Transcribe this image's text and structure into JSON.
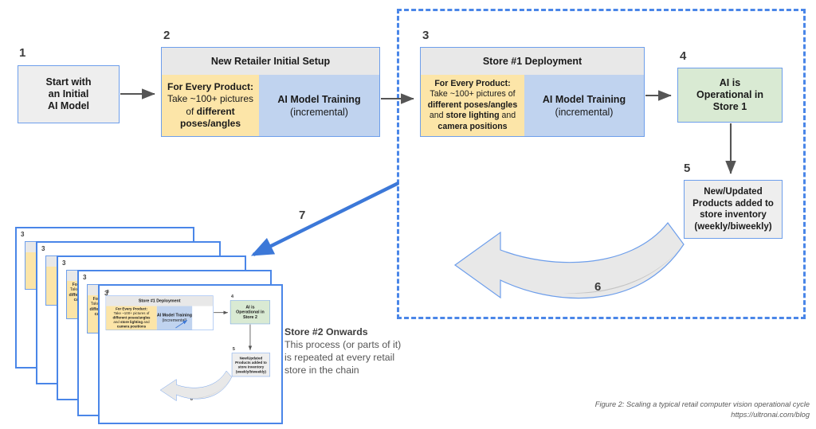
{
  "figure": {
    "caption": "Figure 2: Scaling a typical retail computer vision operational cycle",
    "source_url": "https://ultronai.com/blog"
  },
  "numbers": {
    "n1": "1",
    "n2": "2",
    "n3": "3",
    "n4": "4",
    "n5": "5",
    "n6": "6",
    "n7": "7"
  },
  "nodes": {
    "box1": {
      "number": "1",
      "line1": "Start with",
      "line2": "an Initial",
      "line3": "AI Model"
    },
    "box2": {
      "number": "2",
      "header": "New Retailer Initial Setup",
      "yellow": {
        "title": "For Every Product:",
        "l1": "Take ~100+ pictures",
        "l2_plain": "of ",
        "l2_bold": "different",
        "l3_bold": "poses/angles"
      },
      "blue": {
        "title": "AI Model Training",
        "subtitle": "(incremental)"
      }
    },
    "box3": {
      "number": "3",
      "header": "Store #1 Deployment",
      "yellow": {
        "title": "For Every Product:",
        "l1": "Take ~100+ pictures of",
        "l2_bold": "different poses/angles",
        "l3_plain_a": "and ",
        "l3_bold": "store lighting",
        "l3_plain_b": " and",
        "l4_bold": "camera positions"
      },
      "blue": {
        "title": "AI Model Training",
        "subtitle": "(incremental)"
      }
    },
    "box4": {
      "number": "4",
      "line1": "AI is",
      "line2": "Operational in",
      "line3": "Store 1"
    },
    "box5": {
      "number": "5",
      "line1": "New/Updated",
      "line2": "Products added to",
      "line3": "store inventory",
      "line4": "(weekly/biweekly)"
    }
  },
  "mini_card": {
    "number_outer": "3",
    "box3": {
      "number": "3",
      "header": "Store #1 Deployment",
      "yellow": {
        "title": "For Every Product:",
        "l1": "Take ~100+ pictures of",
        "l2_bold": "different poses/angles",
        "l3_plain_a": "and ",
        "l3_bold": "store lighting",
        "l3_plain_b": " and",
        "l4_bold": "camera positions"
      },
      "blue": {
        "title": "AI Model Training",
        "subtitle": "(incremental)"
      }
    },
    "box4": {
      "number": "4",
      "line1": "AI is",
      "line2": "Operational in",
      "line3": "Store 2"
    },
    "box5": {
      "number": "5",
      "line1": "New/Updated",
      "line2": "Products added to",
      "line3": "store inventory",
      "line4": "(weekly/biweekly)"
    },
    "cycle_number": "6"
  },
  "annotation": {
    "title": "Store #2 Onwards",
    "l1": "This process (or parts of it)",
    "l2": "is repeated at every retail",
    "l3": "store in the chain"
  },
  "colors": {
    "box_border_blue": "#6d9eeb",
    "dashed_blue": "#4a86e8",
    "header_grey": "#e8e8e8",
    "yellow_panel": "#fce5a8",
    "blue_panel": "#c0d3ef",
    "green_panel": "#d9ead3",
    "grey_panel": "#eeeeee",
    "arrow_grey": "#555555",
    "cycle_fill": "#e8e8e8",
    "cycle_shadow": "#bdbdbd"
  }
}
